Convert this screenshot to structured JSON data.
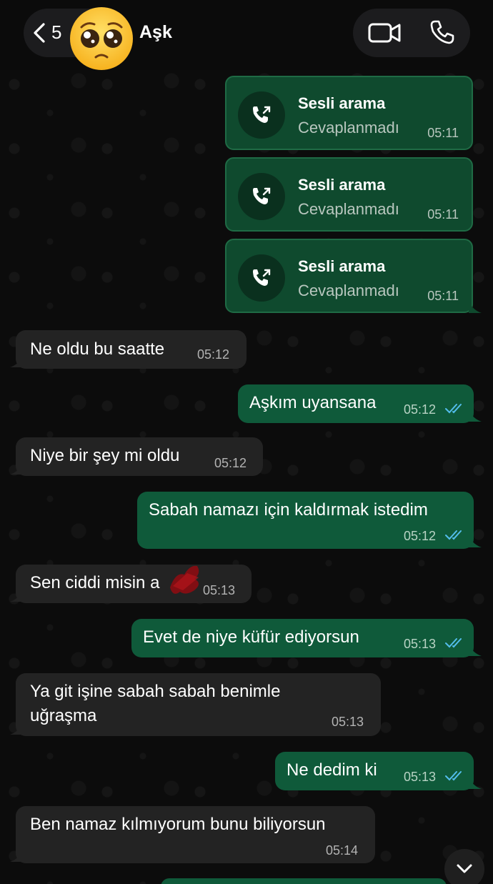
{
  "header": {
    "back_count": "5",
    "contact_name": "Aşk",
    "avatar_icon": "pleading-face-emoji",
    "video_icon": "video-camera-icon",
    "phone_icon": "phone-icon"
  },
  "calls": [
    {
      "title": "Sesli arama",
      "status": "Cevaplanmadı",
      "time": "05:11"
    },
    {
      "title": "Sesli arama",
      "status": "Cevaplanmadı",
      "time": "05:11"
    },
    {
      "title": "Sesli arama",
      "status": "Cevaplanmadı",
      "time": "05:11"
    }
  ],
  "messages": [
    {
      "dir": "in",
      "text": "Ne oldu bu saatte",
      "time": "05:12"
    },
    {
      "dir": "out",
      "text": "Aşkım uyansana",
      "time": "05:12"
    },
    {
      "dir": "in",
      "text": "Niye bir şey mi oldu",
      "time": "05:12"
    },
    {
      "dir": "out",
      "text": "Sabah namazı için kaldırmak istedim",
      "time": "05:12"
    },
    {
      "dir": "in",
      "text": "Sen ciddi misin a",
      "time": "05:13"
    },
    {
      "dir": "out",
      "text": "Evet de niye küfür ediyorsun",
      "time": "05:13"
    },
    {
      "dir": "in",
      "text": "Ya git işine sabah sabah benimle",
      "text2": "uğraşma",
      "time": "05:13"
    },
    {
      "dir": "out",
      "text": "Ne dedim ki",
      "time": "05:13"
    },
    {
      "dir": "in",
      "text": "Ben namaz kılmıyorum bunu biliyorsun",
      "time": "05:14"
    }
  ],
  "colors": {
    "outgoing_bubble": "#0f5a3a",
    "incoming_bubble": "#232323",
    "read_ticks": "#53bdeb"
  }
}
